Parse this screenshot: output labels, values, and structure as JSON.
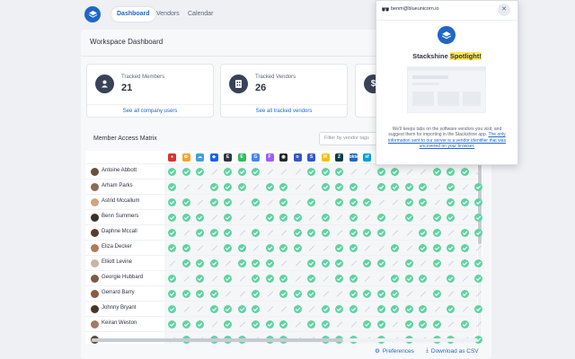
{
  "nav": {
    "tabs": [
      {
        "label": "Dashboard",
        "active": true
      },
      {
        "label": "Vendors",
        "active": false
      },
      {
        "label": "Calendar",
        "active": false
      }
    ]
  },
  "dashboard": {
    "title": "Workspace Dashboard",
    "cards": [
      {
        "label": "Tracked Members",
        "value": "21",
        "link": "See all company users",
        "icon": "users-icon"
      },
      {
        "label": "Tracked Vendors",
        "value": "26",
        "link": "See all tracked vendors",
        "icon": "building-icon"
      },
      {
        "label": "",
        "value": "",
        "link": "",
        "icon": "dollar-icon"
      }
    ]
  },
  "matrix": {
    "title": "Member Access Matrix",
    "filter_placeholder": "Filter by vendor tags",
    "vendors": [
      {
        "icon": "red-vendor-icon",
        "color": "#e0312b",
        "glyph": "●"
      },
      {
        "icon": "multicolor-vendor-icon",
        "color": "#f7a523",
        "glyph": "✿"
      },
      {
        "icon": "cloud-vendor-icon",
        "color": "#3aa0e0",
        "glyph": "☁"
      },
      {
        "icon": "dropbox-icon",
        "color": "#1261fe",
        "glyph": "◆"
      },
      {
        "icon": "e-vendor-icon",
        "color": "#2f3545",
        "glyph": "E"
      },
      {
        "icon": "evernote-icon",
        "color": "#2dbe60",
        "glyph": "E"
      },
      {
        "icon": "google-icon",
        "color": "#4285f4",
        "glyph": "G"
      },
      {
        "icon": "figma-icon",
        "color": "#a259ff",
        "glyph": "F"
      },
      {
        "icon": "github-icon",
        "color": "#24292e",
        "glyph": "◉"
      },
      {
        "icon": "o-vendor-icon",
        "color": "#3556c8",
        "glyph": "o"
      },
      {
        "icon": "stripe-icon",
        "color": "#2f5bd3",
        "glyph": "S"
      },
      {
        "icon": "mailchimp-icon",
        "color": "#f2c200",
        "glyph": "M"
      },
      {
        "icon": "zendesk-icon",
        "color": "#0d3b4c",
        "glyph": "Z"
      },
      {
        "icon": "okta-icon",
        "color": "#1f66c9",
        "glyph": "okta"
      },
      {
        "icon": "salesforce-icon",
        "color": "#00a1e0",
        "glyph": "sf"
      },
      {
        "icon": "blue-vendor-icon",
        "color": "#1ba0d8",
        "glyph": "◎"
      },
      {
        "icon": "settings-vendor-icon",
        "color": "#2f3545",
        "glyph": "⚙"
      },
      {
        "icon": "teal-vendor-icon",
        "color": "#17b4a4",
        "glyph": "◐"
      },
      {
        "icon": "fire-vendor-icon",
        "color": "#f36b21",
        "glyph": "♦"
      },
      {
        "icon": "green-vendor-icon",
        "color": "#40c057",
        "glyph": "●"
      },
      {
        "icon": "dark-vendor-icon",
        "color": "#3a4258",
        "glyph": "▲"
      },
      {
        "icon": "purple-vendor-icon",
        "color": "#7b5cd6",
        "glyph": "◇"
      },
      {
        "icon": "navy-vendor-icon",
        "color": "#24364f",
        "glyph": "■"
      }
    ],
    "members": [
      {
        "name": "Antoine Abbott",
        "avatar": "#6b4f3c",
        "access": "11101110001110011001110"
      },
      {
        "name": "Arham Parks",
        "avatar": "#8a6d55",
        "access": "10011101100111011110101"
      },
      {
        "name": "Astrid Mccallum",
        "avatar": "#d2a37c",
        "access": "11011010101011100110111"
      },
      {
        "name": "Benn Summers",
        "avatar": "#3d2f2a",
        "access": "11101001110101010101101"
      },
      {
        "name": "Daphne Mccall",
        "avatar": "#5a3c2e",
        "access": "10111010011101110011011"
      },
      {
        "name": "Eliza Decker",
        "avatar": "#b07a5a",
        "access": "11001101110011001011110"
      },
      {
        "name": "Elliott Levine",
        "avatar": "#c9b3a2",
        "access": "01110111001110110101011"
      },
      {
        "name": "Georgie Hubbard",
        "avatar": "#7d5a45",
        "access": "10101011101011001110101"
      },
      {
        "name": "Gerrard Barry",
        "avatar": "#8f5a40",
        "access": "11110010111001111001010"
      },
      {
        "name": "Johnny Bryant",
        "avatar": "#4a3428",
        "access": "10011110010111011110101"
      },
      {
        "name": "Keiran Weston",
        "avatar": "#a47b60",
        "access": "11101011101100110111010"
      },
      {
        "name": "",
        "avatar": "#5e4636",
        "access": "01011101100111010101101"
      }
    ]
  },
  "footer": {
    "preferences": "Preferences",
    "download": "Download as CSV"
  },
  "popup": {
    "email": "benm@blueunicorn.io",
    "title_pre": "Stackshine ",
    "title_hl": "Spotlight!",
    "desc": "We'll keeps tabs on the software vendors you visit, and suggest them for importing in the Stackshine app.",
    "desc_link": "The only information sent to our server is a vendor identifier that was uncovered on your browser."
  }
}
